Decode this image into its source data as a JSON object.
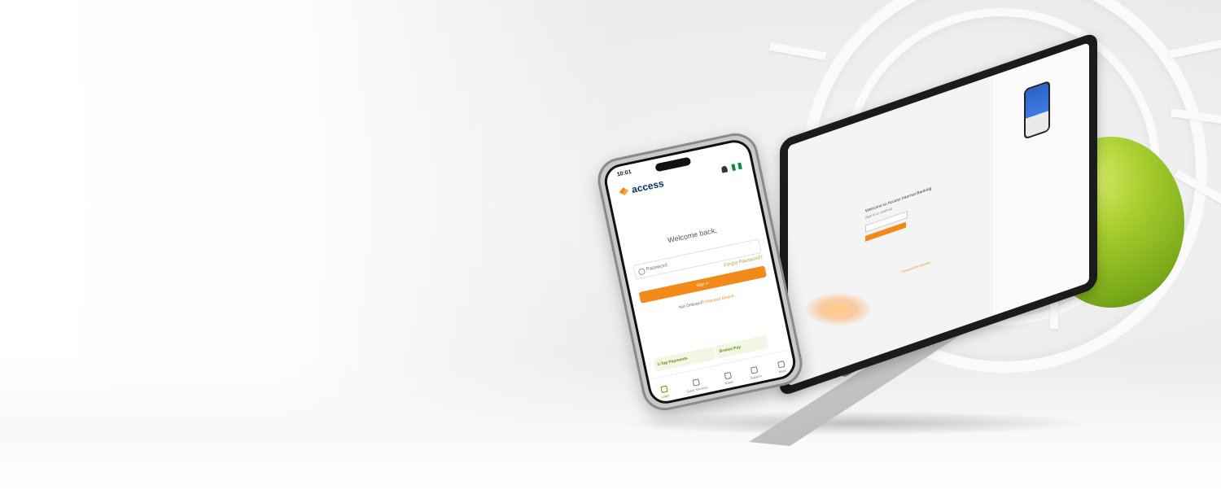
{
  "phone": {
    "status_time": "10:01",
    "brand": "access",
    "welcome_text": "Welcome back,",
    "password_placeholder": "Password",
    "forgot_password": "Forgot Password?",
    "sign_in_label": "Sign In",
    "onboard_prompt": "Not Onboard?",
    "onboard_link": "Onboard Device",
    "quick_actions": [
      "1-Tap Payments",
      "Breeze Pay"
    ],
    "tabs": [
      "Login",
      "Quick Services",
      "Rates",
      "Support",
      "More"
    ]
  },
  "laptop": {
    "title": "Welcome to Access Internet Banking",
    "subtitle": "Sign in to continue",
    "footer": "Powered by Access"
  },
  "colors": {
    "accent_orange": "#f28a1a",
    "accent_green": "#9fb43a",
    "brand_navy": "#0a2f6b",
    "ball_green": "#8bbb22"
  }
}
